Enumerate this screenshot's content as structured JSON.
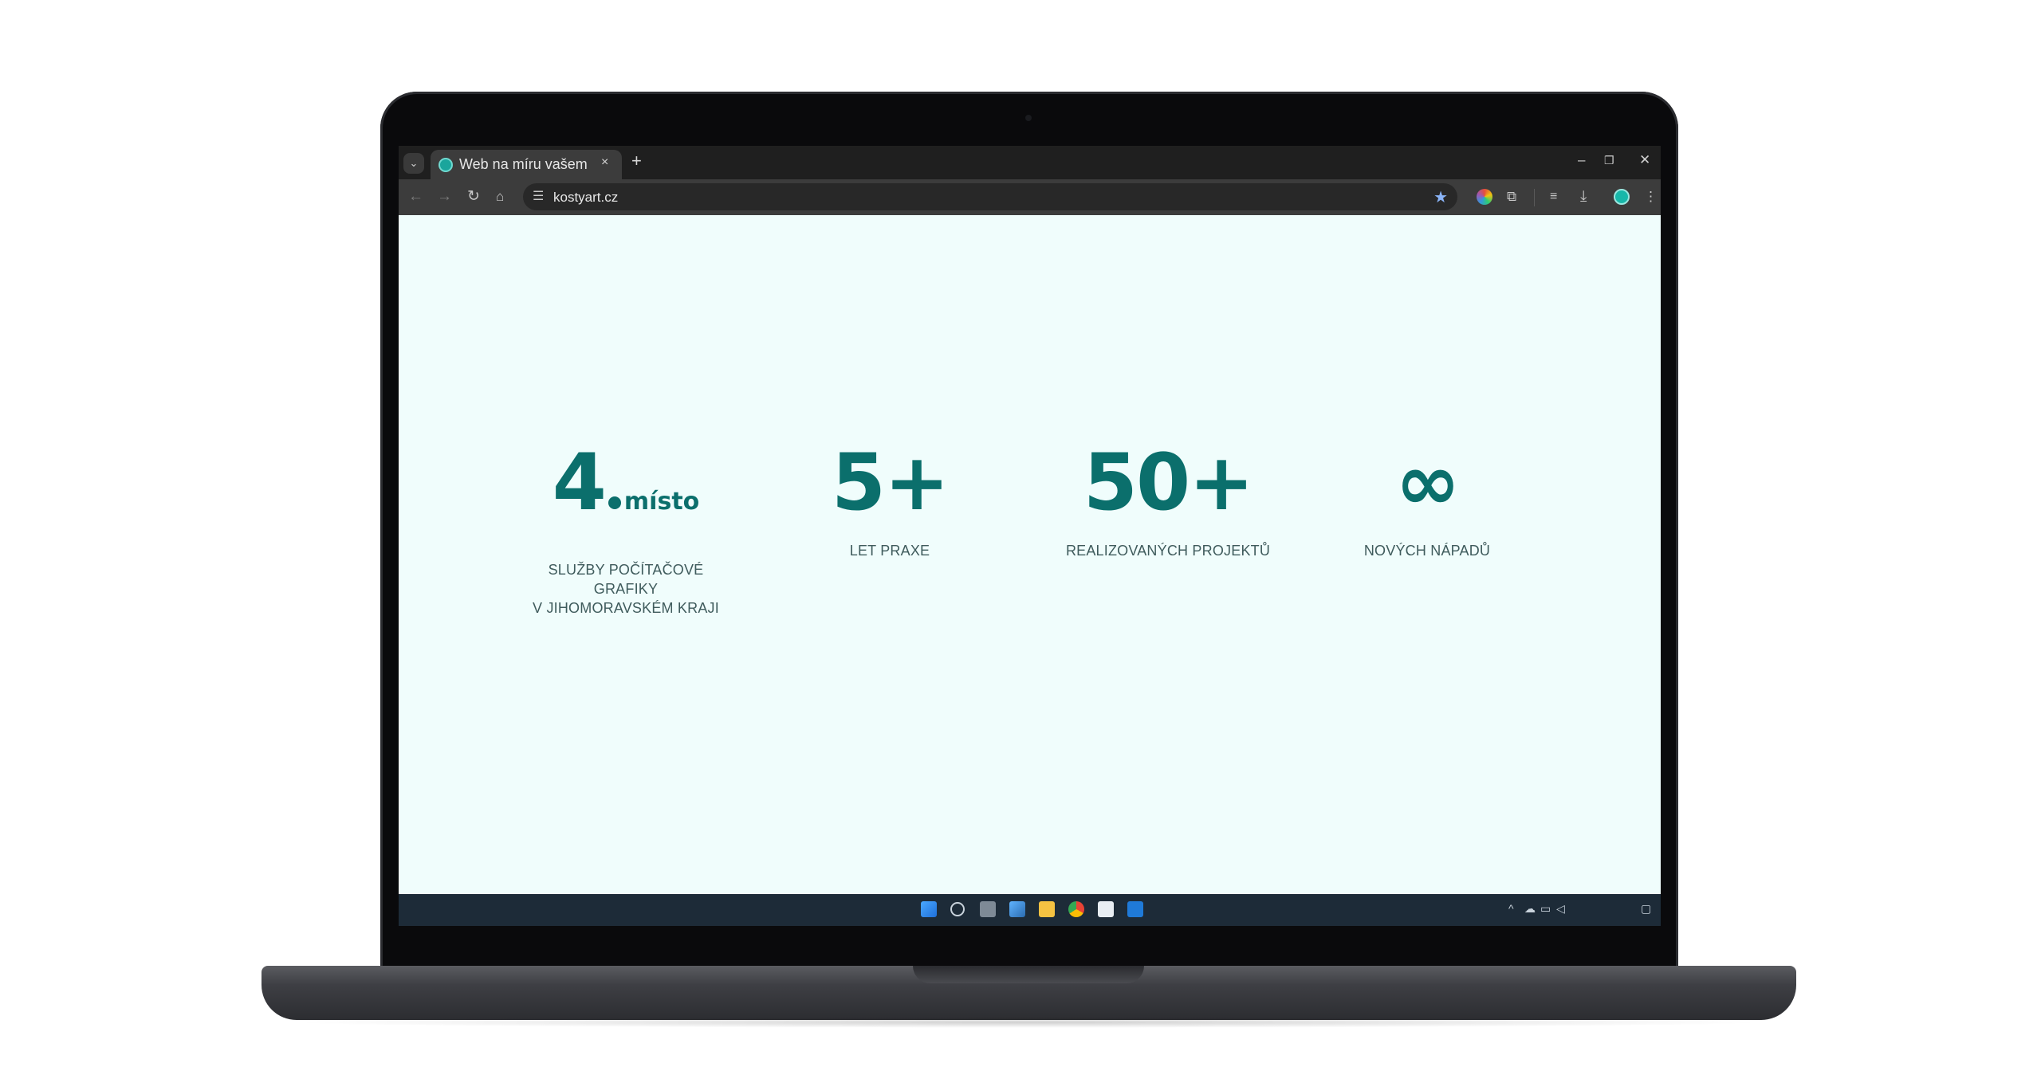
{
  "browser": {
    "tab_title": "Web na míru vašem",
    "url": "kostyart.cz",
    "tab_close": "×",
    "new_tab": "+",
    "window_controls": [
      "–",
      "❐",
      "✕"
    ]
  },
  "stats": [
    {
      "value": "4",
      "suffix": "místo",
      "label_lines": [
        "SLUŽBY POČÍTAČOVÉ GRAFIKY",
        "V JIHOMORAVSKÉM KRAJI"
      ]
    },
    {
      "value": "5+",
      "label_lines": [
        "LET PRAXE"
      ]
    },
    {
      "value": "50+",
      "label_lines": [
        "REALIZOVANÝCH PROJEKTŮ"
      ]
    },
    {
      "value": "∞",
      "label_lines": [
        "NOVÝCH NÁPADŮ"
      ]
    }
  ],
  "taskbar": {
    "icons": [
      "windows-start-icon",
      "search-icon",
      "task-view-icon",
      "widgets-icon",
      "file-explorer-icon",
      "chrome-icon",
      "store-icon",
      "outlook-icon"
    ],
    "tray_icons": [
      "chevron-up-icon",
      "cloud-icon",
      "network-icon",
      "volume-icon"
    ]
  },
  "colors": {
    "accent": "#0b6f6c",
    "page_background": "#f0fdfc",
    "taskbar": "#1d2b38"
  }
}
